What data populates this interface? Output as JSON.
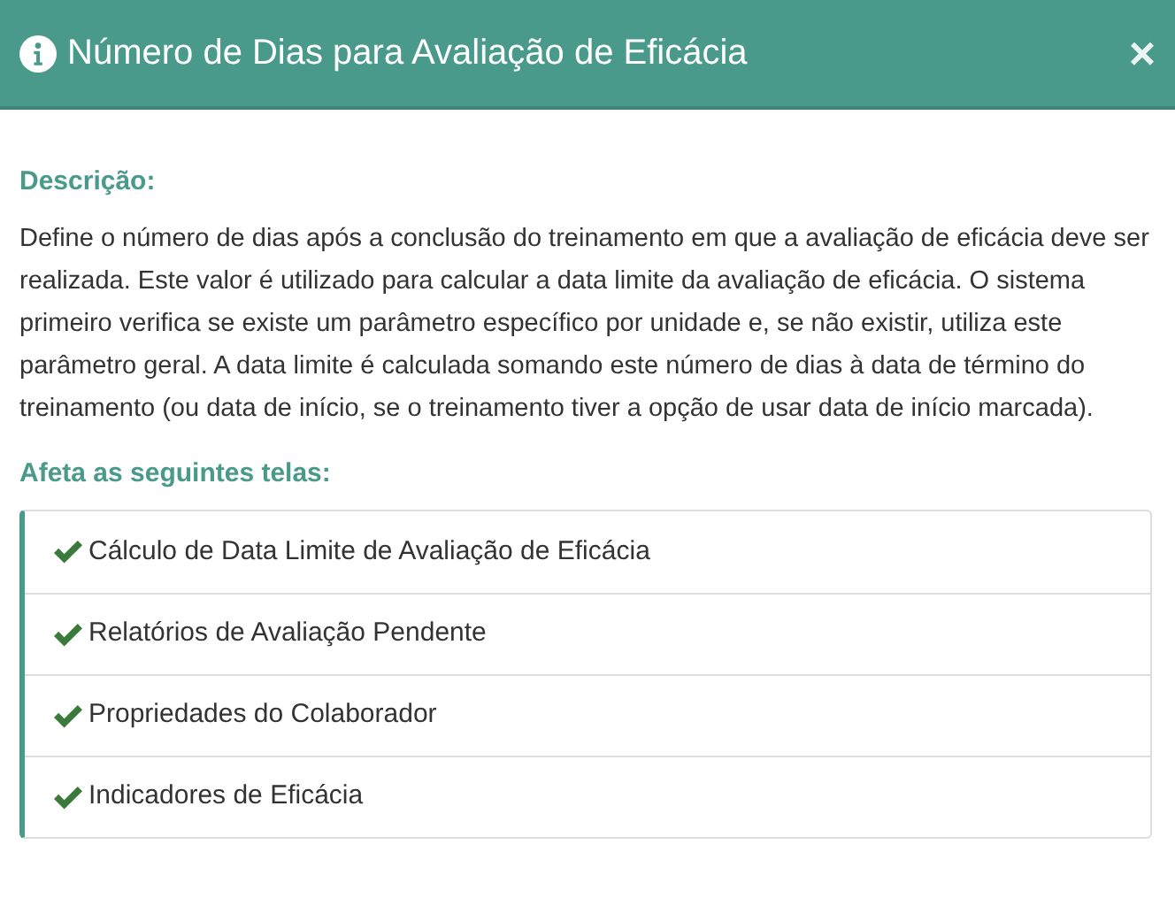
{
  "dialog": {
    "title": "Número de Dias para Avaliação de Eficácia",
    "close": "×"
  },
  "description": {
    "heading": "Descrição:",
    "text": "Define o número de dias após a conclusão do treinamento em que a avaliação de eficácia deve ser realizada. Este valor é utilizado para calcular a data limite da avaliação de eficácia. O sistema primeiro verifica se existe um parâmetro específico por unidade e, se não existir, utiliza este parâmetro geral. A data limite é calculada somando este número de dias à data de término do treinamento (ou data de início, se o treinamento tiver a opção de usar data de início marcada)."
  },
  "affected": {
    "heading": "Afeta as seguintes telas:",
    "items": [
      {
        "label": "Cálculo de Data Limite de Avaliação de Eficácia"
      },
      {
        "label": "Relatórios de Avaliação Pendente"
      },
      {
        "label": "Propriedades do Colaborador"
      },
      {
        "label": "Indicadores de Eficácia"
      }
    ]
  }
}
